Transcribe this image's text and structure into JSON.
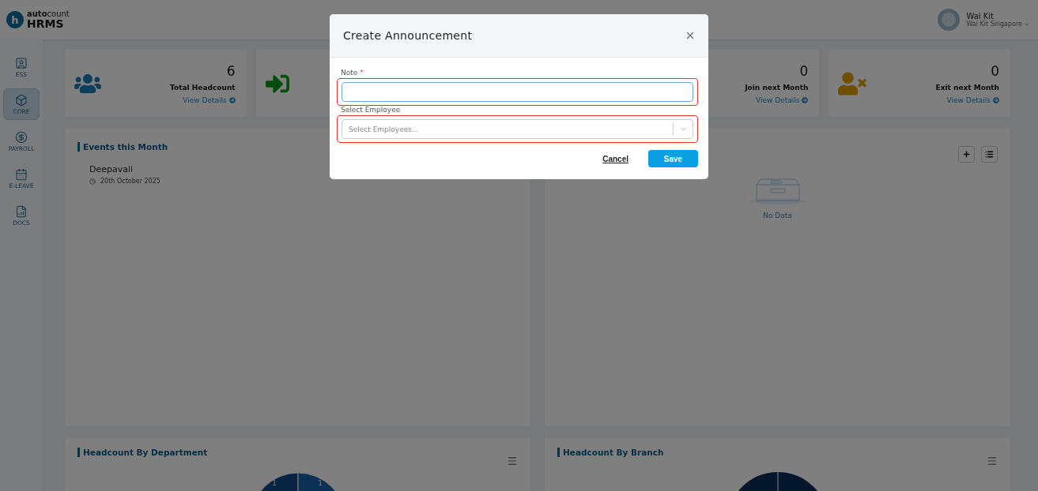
{
  "logo": {
    "mark": "h",
    "brand": "**auto**count",
    "product": "HRMS"
  },
  "user": {
    "name": "Wai Kit",
    "company": "Wai Kit Singapore"
  },
  "sidebar": {
    "items": [
      {
        "label": "ESS",
        "kind": "ess",
        "selected": false
      },
      {
        "label": "CORE",
        "kind": "core",
        "selected": true
      },
      {
        "label": "PAYROLL",
        "kind": "payroll",
        "selected": false
      },
      {
        "label": "E-LEAVE",
        "kind": "leave",
        "selected": false
      },
      {
        "label": "DOCS",
        "kind": "docs",
        "selected": false
      }
    ]
  },
  "stat_cards": [
    {
      "kind": "headcount",
      "value": "6",
      "label": "Total Headcount",
      "link": "View Details"
    },
    {
      "kind": "join"
    },
    {
      "kind": "none",
      "value": "0",
      "label": "Join next Month",
      "link": "View Details"
    },
    {
      "kind": "exit",
      "value": "0",
      "label": "Exit next Month",
      "link": "View Details"
    }
  ],
  "events_panel": {
    "title": "Events this Month",
    "events": [
      {
        "name": "Deepavali",
        "date": "20th October 2025"
      }
    ]
  },
  "announcements_panel": {
    "empty_text": "No Data"
  },
  "department_chart": {
    "title": "Headcount By Department",
    "slice_labels": [
      "1",
      "1"
    ]
  },
  "branch_chart": {
    "title": "Headcount By Branch"
  },
  "modal": {
    "title": "Create Announcement",
    "note": {
      "label": "Note",
      "required_mark": "*",
      "focused": true,
      "highlighted": true
    },
    "employee": {
      "label": "Select Employee",
      "placeholder": "Select Employees...",
      "highlighted": true
    },
    "buttons": [
      {
        "label": "Cancel",
        "kind": "link"
      },
      {
        "label": "Save",
        "kind": "primary"
      }
    ]
  }
}
